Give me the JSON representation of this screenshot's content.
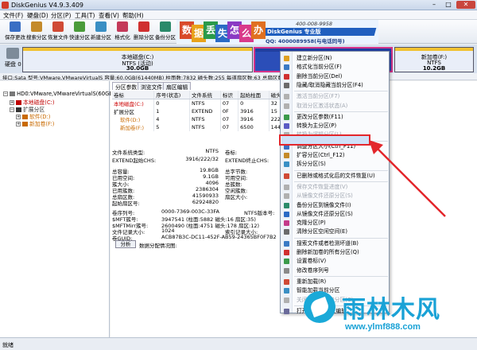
{
  "app": {
    "title": "DiskGenius V4.9.3.409"
  },
  "window_controls": {
    "minimize": "–",
    "maximize": "□",
    "close": "✕"
  },
  "menu": [
    "文件(F)",
    "硬盘(D)",
    "分区(P)",
    "工具(T)",
    "查看(V)",
    "帮助(H)"
  ],
  "toolbar": [
    {
      "label": "保存更改",
      "icon": "save-icon",
      "color": "#3a6fc4"
    },
    {
      "label": "搜索分区",
      "icon": "search-icon",
      "color": "#c48a2a"
    },
    {
      "label": "恢复文件",
      "icon": "recover-icon",
      "color": "#d04a35"
    },
    {
      "label": "快速分区",
      "icon": "quick-partition-icon",
      "color": "#4a9b3a"
    },
    {
      "label": "新建分区",
      "icon": "new-partition-icon",
      "color": "#3a8fc4"
    },
    {
      "label": "格式化",
      "icon": "format-icon",
      "color": "#c43a5a"
    },
    {
      "label": "删除分区",
      "icon": "delete-partition-icon",
      "color": "#d03030"
    },
    {
      "label": "备份分区",
      "icon": "backup-icon",
      "color": "#2a8a6a"
    }
  ],
  "banner": {
    "chips": [
      {
        "text": "数",
        "color": "#d94a2a"
      },
      {
        "text": "据",
        "color": "#e8a21a"
      },
      {
        "text": "丢",
        "color": "#2a9a4a"
      },
      {
        "text": "失",
        "color": "#2a6ac4"
      },
      {
        "text": "怎",
        "color": "#8a3ac4"
      },
      {
        "text": "么",
        "color": "#d93a8a"
      },
      {
        "text": "办",
        "color": "#e07020"
      }
    ],
    "product": "DiskGenius 专业版",
    "qq": "QQ: 4000089958(与电话同号)",
    "phone": "400-008-9958"
  },
  "disk_map": {
    "disk_label": "硬盘 0",
    "partitions": [
      {
        "name": "本地磁盘(C:)",
        "fs": "NTFS (活动)",
        "size": "30.0GB",
        "color": "#f1c232"
      },
      {
        "name": "",
        "fs": "",
        "size": "",
        "color": "#1f3f9f"
      },
      {
        "name": "新加卷(F:)",
        "fs": "NTFS",
        "size": "10.2GB",
        "color": "#f1c232"
      }
    ]
  },
  "info_line": "接口:Sata  型号:VMware,VMwareVirtualS  容量:60.0GB(61440MB)  柱面数:7832  磁头数:255  每道扇区数:63  总扇区数:125829120",
  "tree": [
    {
      "label": "HD0:VMware,VMwareVirtualS(60GB)",
      "level": 0,
      "color": "#777777"
    },
    {
      "label": "本地磁盘(C:)",
      "level": 1,
      "color": "#c00000"
    },
    {
      "label": "扩展分区",
      "level": 1,
      "color": "#333333"
    },
    {
      "label": "软件(D:)",
      "level": 2,
      "color": "#c96a00"
    },
    {
      "label": "新加卷(F:)",
      "level": 2,
      "color": "#c96a00"
    }
  ],
  "tabs": [
    "分区参数",
    "浏览文件",
    "扇区编辑"
  ],
  "partition_table": {
    "headers": [
      "卷标",
      "序号(状态)",
      "文件系统",
      "标识",
      "起始柱面",
      "磁头"
    ],
    "rows": [
      {
        "cells": [
          "本地磁盘(C:)",
          "0",
          "NTFS",
          "07",
          "0",
          "32"
        ],
        "cls": "c-red"
      },
      {
        "cells": [
          "扩展分区",
          "1",
          "EXTEND",
          "0F",
          "3916",
          "15"
        ],
        "cls": ""
      },
      {
        "cells": [
          "软件(D:)",
          "4",
          "NTFS",
          "07",
          "3916",
          "222"
        ],
        "cls": "c-orange"
      },
      {
        "cells": [
          "新加卷(F:)",
          "5",
          "NTFS",
          "07",
          "6500",
          "144"
        ],
        "cls": "c-orange"
      }
    ]
  },
  "fs_info": [
    {
      "k": "文件系统类型:",
      "v": "NTFS",
      "k2": "卷标:",
      "v2": ""
    },
    {
      "k": "EXTEND起始CHS:",
      "v": "3916/222/32",
      "k2": "EXTEND终止CHS:",
      "v2": ""
    },
    {
      "k": "总容量:",
      "v": "19.8GB",
      "k2": "总字节数:",
      "v2": ""
    },
    {
      "k": "已用空间:",
      "v": "9.1GB",
      "k2": "可用空间:",
      "v2": ""
    },
    {
      "k": "簇大小:",
      "v": "4096",
      "k2": "总簇数:",
      "v2": ""
    },
    {
      "k": "已用簇数:",
      "v": "2386304",
      "k2": "空闲簇数:",
      "v2": ""
    },
    {
      "k": "总扇区数:",
      "v": "41590933",
      "k2": "扇区大小:",
      "v2": ""
    },
    {
      "k": "起始扇区号:",
      "v": "62924820",
      "k2": "",
      "v2": ""
    },
    {
      "k": "卷序列号:",
      "v": "0000-7369-003C-33FA",
      "k2": "NTFS版本号:",
      "v2": ""
    },
    {
      "k": "$MFT簇号:",
      "v": "3947541 (柱面:5882 磁头:16 扇区:35)",
      "k2": "",
      "v2": ""
    },
    {
      "k": "$MFTMirr簇号:",
      "v": "2600490 (柱面:4751 磁头:178 扇区:12)",
      "k2": "",
      "v2": ""
    },
    {
      "k": "文件记录大小:",
      "v": "1024",
      "k2": "索引记录大小:",
      "v2": ""
    },
    {
      "k": "卷GUID:",
      "v": "ACB87B3C-DC11-452F-AB59-24365BF0F7B2",
      "k2": "",
      "v2": ""
    }
  ],
  "analyze": {
    "button": "分析",
    "text": "数据分配情况图:"
  },
  "context_menu": [
    {
      "label": "建立新分区(N)",
      "disabled": false,
      "color": "#e0a020"
    },
    {
      "label": "格式化当前分区(F)",
      "disabled": false,
      "color": "#3a7ac4"
    },
    {
      "label": "删除当前分区(Del)",
      "disabled": false,
      "color": "#d03030"
    },
    {
      "label": "隐藏/取消隐藏当前分区(F4)",
      "disabled": false,
      "color": "#6a6a6a"
    },
    {
      "label": "激活当前分区(F7)",
      "disabled": true,
      "color": "#b0b0b0"
    },
    {
      "label": "取消分区激活状态(A)",
      "disabled": true,
      "color": "#b0b0b0"
    },
    {
      "label": "更改分区参数(F11)",
      "disabled": false,
      "color": "#3a9a4a"
    },
    {
      "label": "转换为主分区(P)",
      "disabled": false,
      "color": "#5a5ac4"
    },
    {
      "label": "转换为逻辑分区(L)",
      "disabled": true,
      "color": "#b0b0b0"
    },
    {
      "label": "调整分区大小(Ctrl_F11)",
      "disabled": false,
      "color": "#3a6fc4"
    },
    {
      "label": "扩容分区(Ctrl_F12)",
      "disabled": false,
      "color": "#c48a2a"
    },
    {
      "label": "拆分分区(S)",
      "disabled": false,
      "color": "#3a8fc4"
    },
    {
      "label": "已删除或格式化后的文件恢复(U)",
      "disabled": false,
      "color": "#d04a35"
    },
    {
      "label": "保存文件恢复进度(V)",
      "disabled": true,
      "color": "#b0b0b0"
    },
    {
      "label": "从镜像文件还原分区(S)",
      "disabled": true,
      "color": "#b0b0b0"
    },
    {
      "label": "备份分区到镜像文件(I)",
      "disabled": false,
      "color": "#2a8a6a"
    },
    {
      "label": "从镜像文件还原分区(S)",
      "disabled": false,
      "color": "#2a6ac4"
    },
    {
      "label": "克隆分区(P)",
      "disabled": false,
      "color": "#c43a8a"
    },
    {
      "label": "清除分区空闲空间(E)",
      "disabled": false,
      "color": "#6a6a6a"
    },
    {
      "label": "搜索文件或者检测坏道(B)",
      "disabled": false,
      "color": "#3a7ac4"
    },
    {
      "label": "删除新加卷的所有分区(Q)",
      "disabled": false,
      "color": "#d03030"
    },
    {
      "label": "设置卷标(V)",
      "disabled": false,
      "color": "#3a9a4a"
    },
    {
      "label": "修改卷序列号",
      "disabled": false,
      "color": "#8a8a8a"
    },
    {
      "label": "重新加载(R)",
      "disabled": false,
      "color": "#d04a35"
    },
    {
      "label": "智能加载当前分区",
      "disabled": false,
      "color": "#3a8fc4"
    },
    {
      "label": "关闭正在恢复的分区(C)",
      "disabled": true,
      "color": "#b0b0b0"
    },
    {
      "label": "打开16进制扇区编辑",
      "disabled": false,
      "color": "#6a6a9a"
    }
  ],
  "watermark": {
    "title": "雨林木风",
    "url": "www.ylmf888.com",
    "color": "#1aa2d6"
  },
  "status": {
    "text": "就绪"
  }
}
